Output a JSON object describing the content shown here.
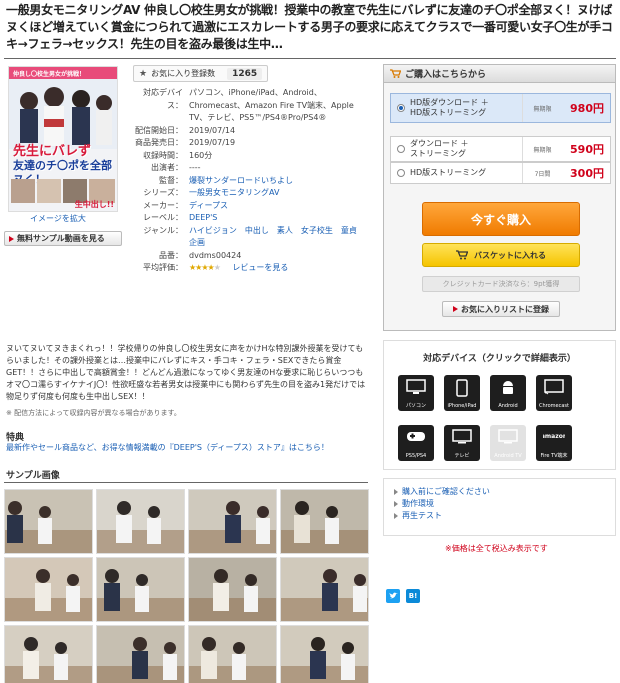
{
  "page": {
    "title": "一般男女モニタリングAV 仲良し〇校生男女が挑戦！授業中の教室で先生にバレずに友達のチ〇ポ全部ヌく！ヌけばヌくほど増えていく賞金につられて過激にエスカレートする男子の要求に応えてクラスで一番可愛い女子〇生が手コキ→フェラ→セックス！先生の目を盗み最後は生中…"
  },
  "cover": {
    "tag_top": "仲良し〇校生男女が挑戦！",
    "headline_1": "先生にバレず",
    "headline_2": "友達のチ〇ポを全部ヌく！",
    "tag_bottom": "生中出し!!",
    "enlarge_label": "イメージを拡大",
    "sample_video_label": "無料サンプル動画を見る"
  },
  "favorites": {
    "label": "お気に入り登録数",
    "count": "1265"
  },
  "specs": [
    {
      "label": "対応デバイス：",
      "value": "パソコン、iPhone/iPad、Android、Chromecast、Amazon Fire TV端末、Apple TV、テレビ、PS5™/PS4®Pro/PS4®",
      "link": false
    },
    {
      "label": "配信開始日：",
      "value": "2019/07/14",
      "link": false
    },
    {
      "label": "商品発売日：",
      "value": "2019/07/19",
      "link": false
    },
    {
      "label": "収録時間：",
      "value": "160分",
      "link": false
    },
    {
      "label": "出演者：",
      "value": "----",
      "link": false
    },
    {
      "label": "監督：",
      "value": "爆裂サンダーロードいちよし",
      "link": true
    },
    {
      "label": "シリーズ：",
      "value": "一般男女モニタリングAV",
      "link": true
    },
    {
      "label": "メーカー：",
      "value": "ディープス",
      "link": true
    },
    {
      "label": "レーベル：",
      "value": "DEEP'S",
      "link": true
    },
    {
      "label": "ジャンル：",
      "value": "ハイビジョン　中出し　素人　女子校生　童貞　企画",
      "link": true
    },
    {
      "label": "品番：",
      "value": "dvdms00424",
      "link": false
    }
  ],
  "rating": {
    "label": "平均評価：",
    "stars": 3.5,
    "max": 5,
    "review_link": "レビューを見る"
  },
  "description": "ヌいてヌいてヌきまくれっ！！学校帰りの仲良し〇校生男女に声をかけHな特別課外授業を受けてもらいました！その課外授業とは…授業中にバレずにキス・手コキ・フェラ・SEXできたら賞金GET！！さらに中出しで高額賞金！！どんどん過激になってゆく男友達のHな要求に恥じらいつつもオマ〇コ濡らすイケナイJ〇！性欲旺盛な若者男女は授業中にも関わらず先生の目を盗み1発だけでは物足りず何度も何度も生中出しSEX！！",
  "note": "※ 配信方法によって収録内容が異なる場合があります。",
  "tokuten": {
    "heading": "特典",
    "link": "最新作やセール商品など、お得な情報満載の『DEEP'S（ディープス）ストア』はこちら！"
  },
  "samples": {
    "heading": "サンプル画像",
    "count": 12
  },
  "purchase": {
    "heading": "ご購入はこちらから",
    "options": [
      {
        "label_1": "HD版ダウンロード ＋",
        "label_2": "HD版ストリーミング",
        "term": "無期限",
        "price": "980円",
        "selected": true
      },
      {
        "label_1": "ダウンロード ＋",
        "label_2": "ストリーミング",
        "term": "無期限",
        "price": "590円",
        "selected": false
      },
      {
        "label_1": "HD版ストリーミング",
        "label_2": "",
        "term": "7日間",
        "price": "300円",
        "selected": false
      }
    ],
    "buy_now": "今すぐ購入",
    "add_basket": "バスケットに入れる",
    "card_note": "クレジットカード決済なら：9pt獲得",
    "add_favorite": "お気に入りリストに登録"
  },
  "devices": {
    "heading": "対応デバイス（クリックで詳細表示）",
    "items": [
      {
        "name": "パソコン",
        "icon": "monitor-icon",
        "enabled": true
      },
      {
        "name": "iPhone/iPad",
        "icon": "phone-icon",
        "enabled": true
      },
      {
        "name": "Android",
        "icon": "android-icon",
        "enabled": true
      },
      {
        "name": "Chromecast",
        "icon": "cast-icon",
        "enabled": true
      },
      {
        "name": "PS5/PS4",
        "icon": "gamepad-icon",
        "enabled": true
      },
      {
        "name": "テレビ",
        "icon": "tv-icon",
        "enabled": true
      },
      {
        "name": "Android TV",
        "icon": "tv-icon",
        "enabled": false
      },
      {
        "name": "Fire TV端末",
        "icon": "amazon-icon",
        "enabled": true
      }
    ]
  },
  "help_links": [
    "購入前にご確認ください",
    "動作環境",
    "再生テスト"
  ],
  "tax_note": "※価格は全て税込み表示です",
  "share": {
    "twitter_color": "#1da1f2",
    "hatena_color": "#0b8ad8",
    "hatena_label": "B!"
  },
  "colors": {
    "price": "#d0021b",
    "link": "#1a5fb4",
    "buy": "#f07b00",
    "basket": "#f5c400"
  }
}
